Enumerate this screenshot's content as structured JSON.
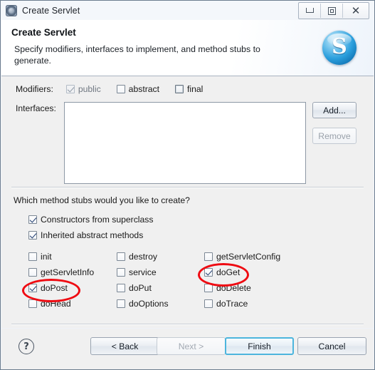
{
  "window": {
    "title": "Create Servlet",
    "icon": "servlet-window-icon",
    "controls": {
      "minimize": "–",
      "maximize": "□",
      "close": "✕"
    }
  },
  "banner": {
    "title": "Create Servlet",
    "description": "Specify modifiers, interfaces to implement, and method stubs to generate.",
    "logo_letter": "S",
    "logo_color": "#2b9fdd"
  },
  "form": {
    "modifiers_label": "Modifiers:",
    "modifiers": [
      {
        "label": "public",
        "checked": true,
        "enabled": false
      },
      {
        "label": "abstract",
        "checked": false,
        "enabled": true
      },
      {
        "label": "final",
        "checked": false,
        "enabled": true
      }
    ],
    "interfaces_label": "Interfaces:",
    "interfaces_items": [],
    "add_button": "Add...",
    "remove_button": "Remove"
  },
  "stubs": {
    "question": "Which method stubs would you like to create?",
    "top_options": [
      {
        "label": "Constructors from superclass",
        "checked": true
      },
      {
        "label": "Inherited abstract methods",
        "checked": true
      }
    ],
    "grid": [
      {
        "label": "init",
        "checked": false,
        "col": 1,
        "row": 1
      },
      {
        "label": "destroy",
        "checked": false,
        "col": 2,
        "row": 1
      },
      {
        "label": "getServletConfig",
        "checked": false,
        "col": 3,
        "row": 1
      },
      {
        "label": "getServletInfo",
        "checked": false,
        "col": 1,
        "row": 2
      },
      {
        "label": "service",
        "checked": false,
        "col": 2,
        "row": 2
      },
      {
        "label": "doGet",
        "checked": true,
        "col": 3,
        "row": 2
      },
      {
        "label": "doPost",
        "checked": true,
        "col": 1,
        "row": 3
      },
      {
        "label": "doPut",
        "checked": false,
        "col": 2,
        "row": 3
      },
      {
        "label": "doDelete",
        "checked": false,
        "col": 3,
        "row": 3
      },
      {
        "label": "doHead",
        "checked": false,
        "col": 1,
        "row": 4
      },
      {
        "label": "doOptions",
        "checked": false,
        "col": 2,
        "row": 4
      },
      {
        "label": "doTrace",
        "checked": false,
        "col": 3,
        "row": 4
      }
    ]
  },
  "footer": {
    "help": "?",
    "back": "< Back",
    "next": "Next >",
    "finish": "Finish",
    "cancel": "Cancel"
  },
  "annotations": {
    "color": "#ef0b12",
    "highlighted": [
      "doGet",
      "doPost"
    ]
  }
}
